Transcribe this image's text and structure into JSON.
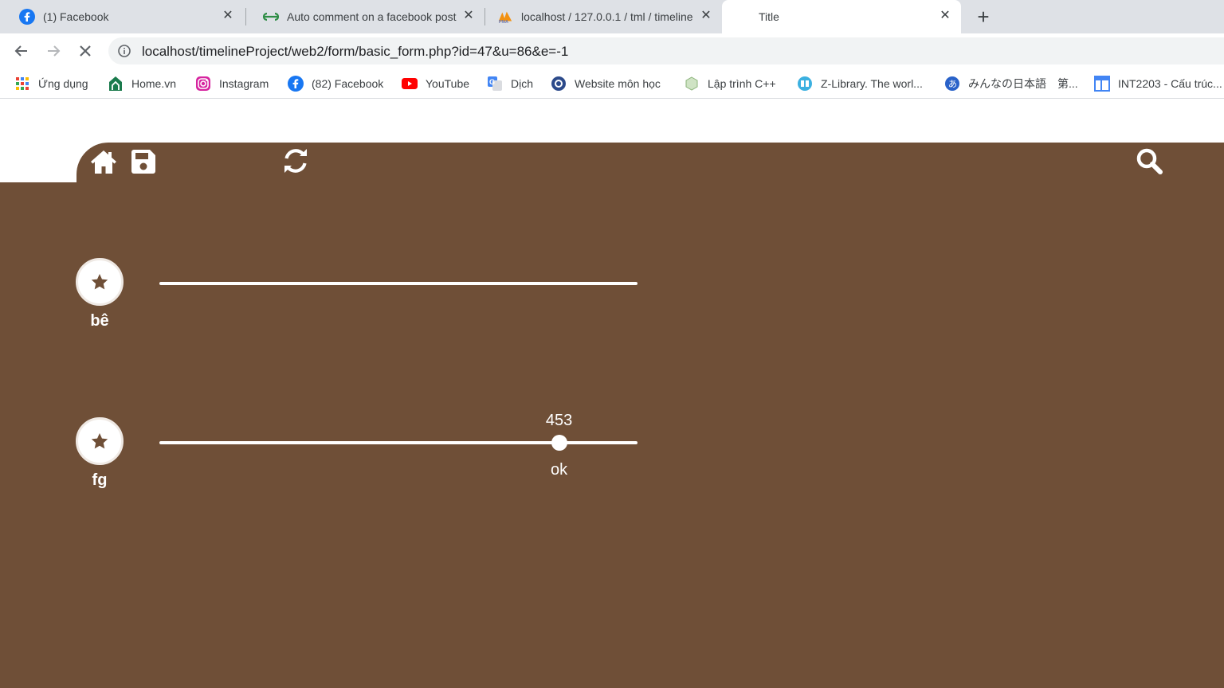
{
  "browser": {
    "tabs": [
      {
        "title": "(1) Facebook",
        "icon": "facebook-icon"
      },
      {
        "title": "Auto comment on a facebook post",
        "icon": "geeksforgeeks-icon"
      },
      {
        "title": "localhost / 127.0.0.1 / tml / timeline",
        "icon": "phpmyadmin-icon"
      },
      {
        "title": "Title",
        "icon": ""
      }
    ],
    "close_glyph": "✕",
    "new_tab_glyph": "+",
    "url": "localhost/timelineProject/web2/form/basic_form.php?id=47&u=86&e=-1"
  },
  "bookmarks": [
    {
      "label": "Ứng dụng",
      "icon": "apps-grid-icon"
    },
    {
      "label": "Home.vn",
      "icon": "home-vn-icon"
    },
    {
      "label": "Instagram",
      "icon": "instagram-icon"
    },
    {
      "label": "(82) Facebook",
      "icon": "facebook-icon"
    },
    {
      "label": "YouTube",
      "icon": "youtube-icon"
    },
    {
      "label": "Dịch",
      "icon": "google-translate-icon"
    },
    {
      "label": "Website môn học",
      "icon": "globe-icon"
    },
    {
      "label": "Lập trình C++",
      "icon": "cpp-icon"
    },
    {
      "label": "Z-Library. The worl...",
      "icon": "zlibrary-icon"
    },
    {
      "label": "みんなの日本語　第...",
      "icon": "minna-icon"
    },
    {
      "label": "INT2203 - Cấu trúc...",
      "icon": "table-icon"
    }
  ],
  "colors": {
    "brand": "#6f4f37",
    "track": "#ffffff"
  },
  "toolbar_icons": [
    "home-icon",
    "save-icon",
    "refresh-icon",
    "search-icon"
  ],
  "rows": [
    {
      "name": "bê",
      "value": null,
      "label": ""
    },
    {
      "name": "fg",
      "value": "453",
      "label": "ok",
      "fraction": 0.836
    }
  ]
}
